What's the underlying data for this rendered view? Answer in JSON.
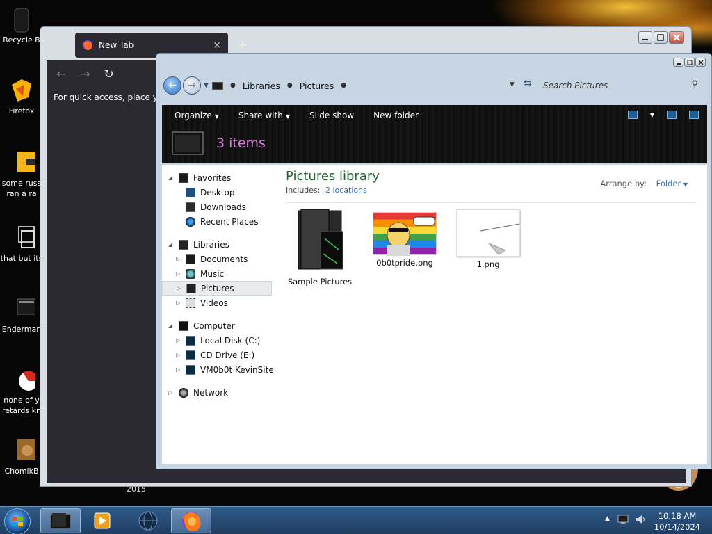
{
  "desktop": {
    "icons": [
      {
        "label": "Recycle B",
        "icon": "recycle-bin-icon"
      },
      {
        "label": "Firefox",
        "icon": "firefox-icon"
      },
      {
        "label": "some russ ran a ra",
        "icon": "folder-icon"
      },
      {
        "label": "that but its",
        "icon": "shortcut-icon"
      },
      {
        "label": "Enderman",
        "icon": "monitor-icon"
      },
      {
        "label": "none of y retards kn",
        "icon": "browser-icon"
      },
      {
        "label": "ChomikB",
        "icon": "hamster-icon"
      }
    ],
    "year_label": "2015"
  },
  "firefox": {
    "tab_title": "New Tab",
    "tab_close": "×",
    "new_tab": "+",
    "bookmarks_hint": "For quick access, place your"
  },
  "explorer": {
    "address": {
      "segments": [
        "Libraries",
        "Pictures"
      ],
      "separator": "●"
    },
    "search_placeholder": "Search Pictures",
    "toolbar": {
      "organize": "Organize",
      "share_with": "Share with",
      "slide_show": "Slide show",
      "new_folder": "New folder"
    },
    "item_count": "3 items",
    "nav": {
      "favorites": "Favorites",
      "desktop": "Desktop",
      "downloads": "Downloads",
      "recent_places": "Recent Places",
      "libraries": "Libraries",
      "documents": "Documents",
      "music": "Music",
      "pictures": "Pictures",
      "videos": "Videos",
      "computer": "Computer",
      "local_disk": "Local Disk (C:)",
      "cd_drive": "CD Drive (E:)",
      "vm_site": "VM0b0t KevinSite",
      "network": "Network"
    },
    "library_title": "Pictures library",
    "includes_label": "Includes:",
    "includes_link": "2 locations",
    "arrange_label": "Arrange by:",
    "arrange_value": "Folder",
    "files": [
      {
        "name": "Sample Pictures"
      },
      {
        "name": "0b0tpride.png"
      },
      {
        "name": "1.png"
      }
    ]
  },
  "taskbar": {
    "time": "10:18 AM",
    "date": "10/14/2024"
  },
  "colors": {
    "library_title": "#1f6a2f",
    "item_count": "#d782d8",
    "link": "#2f6fb0",
    "taskbar": "#2f5b8a"
  }
}
